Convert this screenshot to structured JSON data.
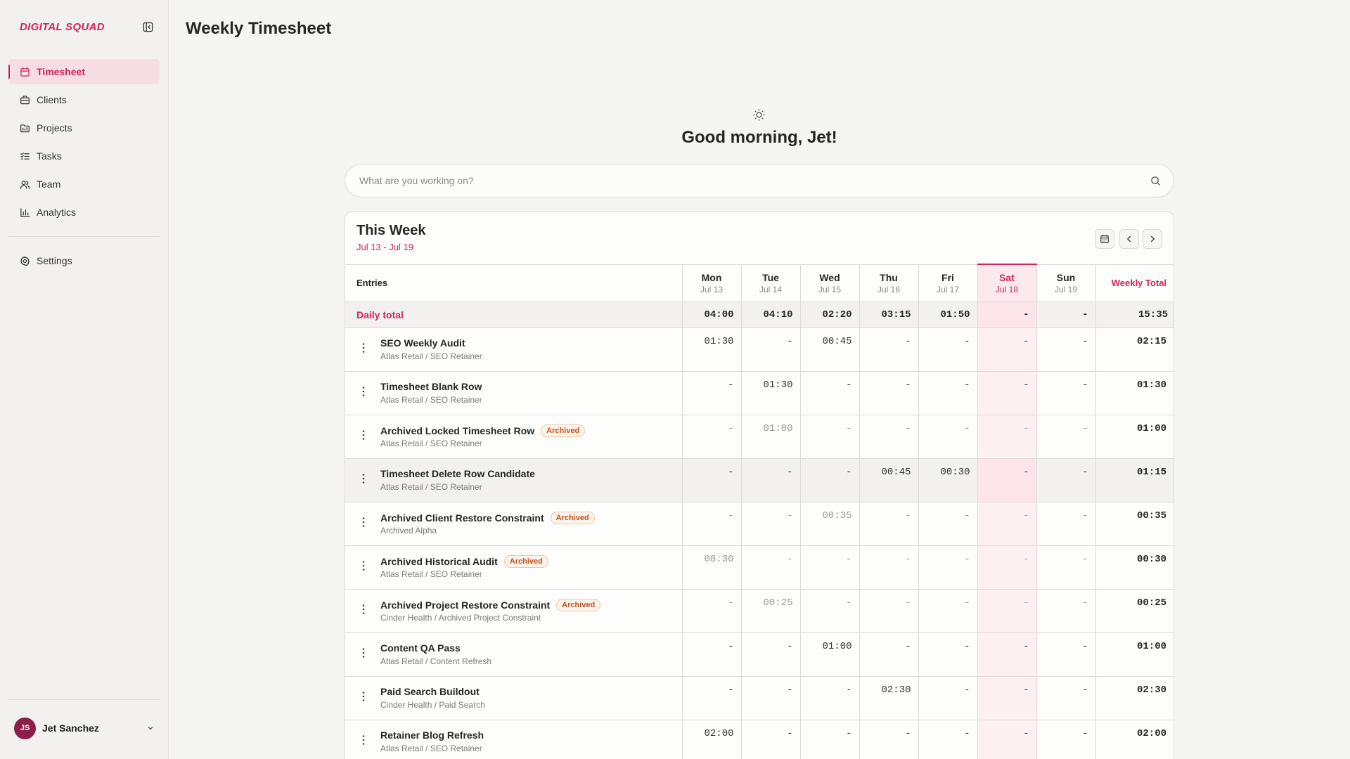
{
  "brand": "DIGITAL SQUAD",
  "sidebar": {
    "items": [
      {
        "label": "Timesheet",
        "icon": "calendar-icon",
        "active": true
      },
      {
        "label": "Clients",
        "icon": "briefcase-icon"
      },
      {
        "label": "Projects",
        "icon": "folder-icon"
      },
      {
        "label": "Tasks",
        "icon": "tasks-icon"
      },
      {
        "label": "Team",
        "icon": "users-icon"
      },
      {
        "label": "Analytics",
        "icon": "bar-chart-icon"
      }
    ],
    "settings": {
      "label": "Settings",
      "icon": "gear-icon"
    },
    "user": {
      "initials": "JS",
      "name": "Jet Sanchez"
    }
  },
  "page": {
    "title": "Weekly Timesheet"
  },
  "greeting": "Good morning, Jet!",
  "search": {
    "placeholder": "What are you working on?"
  },
  "week": {
    "title": "This Week",
    "range": "Jul 13 - Jul 19",
    "entries_header": "Entries",
    "total_header": "Weekly Total",
    "days": [
      {
        "name": "Mon",
        "date": "Jul 13"
      },
      {
        "name": "Tue",
        "date": "Jul 14"
      },
      {
        "name": "Wed",
        "date": "Jul 15"
      },
      {
        "name": "Thu",
        "date": "Jul 16"
      },
      {
        "name": "Fri",
        "date": "Jul 17"
      },
      {
        "name": "Sat",
        "date": "Jul 18",
        "today": true
      },
      {
        "name": "Sun",
        "date": "Jul 19"
      }
    ],
    "daily_total": {
      "label": "Daily total",
      "values": [
        "04:00",
        "04:10",
        "02:20",
        "03:15",
        "01:50",
        "-",
        "-"
      ],
      "total": "15:35"
    },
    "entries": [
      {
        "title": "SEO Weekly Audit",
        "sub": "Atlas Retail / SEO Retainer",
        "archived": false,
        "values": [
          "01:30",
          "-",
          "00:45",
          "-",
          "-",
          "-",
          "-"
        ],
        "total": "02:15"
      },
      {
        "title": "Timesheet Blank Row",
        "sub": "Atlas Retail / SEO Retainer",
        "archived": false,
        "values": [
          "-",
          "01:30",
          "-",
          "-",
          "-",
          "-",
          "-"
        ],
        "total": "01:30"
      },
      {
        "title": "Archived Locked Timesheet Row",
        "sub": "Atlas Retail / SEO Retainer",
        "archived": true,
        "values": [
          "-",
          "01:00",
          "-",
          "-",
          "-",
          "-",
          "-"
        ],
        "total": "01:00"
      },
      {
        "title": "Timesheet Delete Row Candidate",
        "sub": "Atlas Retail / SEO Retainer",
        "archived": false,
        "hover": true,
        "values": [
          "-",
          "-",
          "-",
          "00:45",
          "00:30",
          "-",
          "-"
        ],
        "total": "01:15"
      },
      {
        "title": "Archived Client Restore Constraint",
        "sub": "Archived Alpha",
        "archived": true,
        "values": [
          "-",
          "-",
          "00:35",
          "-",
          "-",
          "-",
          "-"
        ],
        "total": "00:35"
      },
      {
        "title": "Archived Historical Audit",
        "sub": "Atlas Retail / SEO Retainer",
        "archived": true,
        "values": [
          "00:30",
          "-",
          "-",
          "-",
          "-",
          "-",
          "-"
        ],
        "total": "00:30"
      },
      {
        "title": "Archived Project Restore Constraint",
        "sub": "Cinder Health / Archived Project Constraint",
        "archived": true,
        "values": [
          "-",
          "00:25",
          "-",
          "-",
          "-",
          "-",
          "-"
        ],
        "total": "00:25"
      },
      {
        "title": "Content QA Pass",
        "sub": "Atlas Retail / Content Refresh",
        "archived": false,
        "values": [
          "-",
          "-",
          "01:00",
          "-",
          "-",
          "-",
          "-"
        ],
        "total": "01:00"
      },
      {
        "title": "Paid Search Buildout",
        "sub": "Cinder Health / Paid Search",
        "archived": false,
        "values": [
          "-",
          "-",
          "-",
          "02:30",
          "-",
          "-",
          "-"
        ],
        "total": "02:30"
      },
      {
        "title": "Retainer Blog Refresh",
        "sub": "Atlas Retail / SEO Retainer",
        "archived": false,
        "values": [
          "02:00",
          "-",
          "-",
          "-",
          "-",
          "-",
          "-"
        ],
        "total": "02:00"
      }
    ],
    "archived_badge": "Archived"
  },
  "colors": {
    "accent": "#d0245a",
    "avatar": "#8a1f49",
    "badge": "#c0511a"
  }
}
